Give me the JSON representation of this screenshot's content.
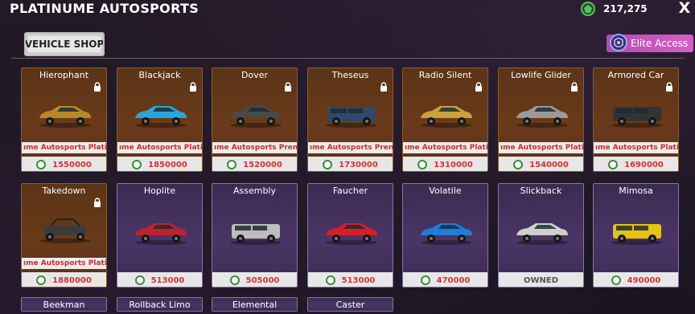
{
  "header": {
    "title": "PLATINUME AUTOSPORTS",
    "currency": "217,275",
    "close": "X"
  },
  "tabs": {
    "vehicle_shop": "VEHICLE SHOP"
  },
  "elite": {
    "label": "Elite Access"
  },
  "colors": {
    "locked_bg": "#5b3418",
    "unlocked_bg": "#3b2b52",
    "price_red": "#d83030",
    "accent_pink": "#d55fc8",
    "currency_green": "#4fc45a"
  },
  "icons": {
    "currency": "currency-icon",
    "lock": "lock-icon",
    "elite": "elite-badge-icon",
    "close": "close-icon"
  },
  "cars": [
    {
      "name": "Hierophant",
      "locked": true,
      "ribbon": "ıme Autosports Plati",
      "price": "1550000",
      "color": "#b58a24",
      "type": "coupe"
    },
    {
      "name": "Blackjack",
      "locked": true,
      "ribbon": "ıme Autosports Plati",
      "price": "1850000",
      "color": "#2aa6d8",
      "type": "super"
    },
    {
      "name": "Dover",
      "locked": true,
      "ribbon": "ıme Autosports Pren",
      "price": "1520000",
      "color": "#4a4a4a",
      "type": "coupe"
    },
    {
      "name": "Theseus",
      "locked": true,
      "ribbon": "ıme Autosports Pren",
      "price": "1730000",
      "color": "#2e4a68",
      "type": "suv"
    },
    {
      "name": "Radio Silent",
      "locked": true,
      "ribbon": "ıme Autosports Plati",
      "price": "1310000",
      "color": "#c9a23a",
      "type": "coupe"
    },
    {
      "name": "Lowlife Glider",
      "locked": true,
      "ribbon": "ıme Autosports Plati",
      "price": "1540000",
      "color": "#9a9a9a",
      "type": "coupe"
    },
    {
      "name": "Armored Car",
      "locked": true,
      "ribbon": "ıme Autosports Plati",
      "price": "1690000",
      "color": "#333333",
      "type": "truck"
    },
    {
      "name": "Takedown",
      "locked": true,
      "ribbon": "ıme Autosports Plati",
      "price": "1880000",
      "color": "#3c3c3c",
      "type": "buggy"
    },
    {
      "name": "Hoplite",
      "locked": false,
      "ribbon": "",
      "price": "513000",
      "color": "#c0222b",
      "type": "sedan"
    },
    {
      "name": "Assembly",
      "locked": false,
      "ribbon": "",
      "price": "505000",
      "color": "#bdbdbd",
      "type": "suv"
    },
    {
      "name": "Faucher",
      "locked": false,
      "ribbon": "",
      "price": "513000",
      "color": "#d61f26",
      "type": "coupe"
    },
    {
      "name": "Volatile",
      "locked": false,
      "ribbon": "",
      "price": "470000",
      "color": "#1e7ed8",
      "type": "coupe"
    },
    {
      "name": "Slickback",
      "locked": false,
      "ribbon": "",
      "price": "OWNED",
      "owned": true,
      "color": "#cfcfcf",
      "type": "sedan"
    },
    {
      "name": "Mimosa",
      "locked": false,
      "ribbon": "",
      "price": "490000",
      "color": "#e6c312",
      "type": "suv"
    },
    {
      "name": "Beekman",
      "locked": false,
      "partial": true
    },
    {
      "name": "Rollback Limo",
      "locked": false,
      "partial": true
    },
    {
      "name": "Elemental",
      "locked": false,
      "partial": true
    },
    {
      "name": "Caster",
      "locked": false,
      "partial": true
    }
  ]
}
